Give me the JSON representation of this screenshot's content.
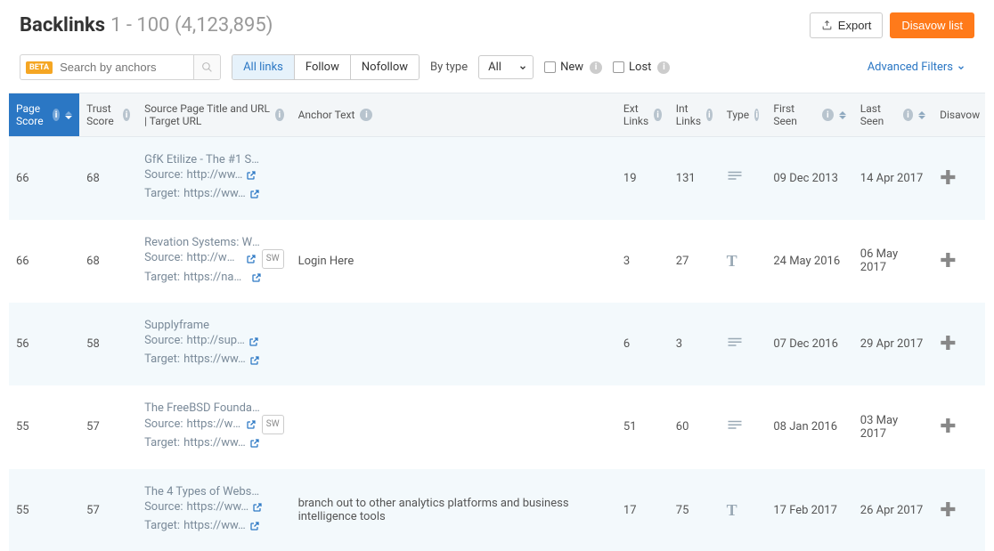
{
  "header": {
    "title": "Backlinks",
    "subtitle": "1 - 100 (4,123,895)",
    "export": "Export",
    "disavow": "Disavow list"
  },
  "toolbar": {
    "beta": "BETA",
    "search_placeholder": "Search by anchors",
    "segments": [
      "All links",
      "Follow",
      "Nofollow"
    ],
    "bytype_label": "By type",
    "bytype_value": "All",
    "new_label": "New",
    "lost_label": "Lost",
    "adv_label": "Advanced Filters"
  },
  "columns": {
    "page_score": "Page Score",
    "trust_score": "Trust Score",
    "source": "Source Page Title and URL | Target URL",
    "anchor": "Anchor Text",
    "ext": "Ext Links",
    "int": "Int Links",
    "type": "Type",
    "first": "First Seen",
    "last": "Last Seen",
    "disavow": "Disavow"
  },
  "rows": [
    {
      "ps": "66",
      "ts": "68",
      "title": "GfK Etilize - The #1 Su…",
      "source": "http://ww…",
      "target": "https://ww…",
      "badge": "",
      "anchor": "",
      "ext": "19",
      "int": "131",
      "type": "lines",
      "first": "09 Dec 2013",
      "last": "14 Apr 2017"
    },
    {
      "ps": "66",
      "ts": "68",
      "title": "Revation Systems: We…",
      "source": "http://ww…",
      "target": "https://na8…",
      "badge": "SW",
      "anchor": "Login Here",
      "ext": "3",
      "int": "27",
      "type": "T",
      "first": "24 May 2016",
      "last": "06 May 2017"
    },
    {
      "ps": "56",
      "ts": "58",
      "title": "Supplyframe",
      "source": "http://sup…",
      "target": "https://ww…",
      "badge": "",
      "anchor": "",
      "ext": "6",
      "int": "3",
      "type": "lines",
      "first": "07 Dec 2016",
      "last": "29 Apr 2017"
    },
    {
      "ps": "55",
      "ts": "57",
      "title": "The FreeBSD Foundat…",
      "source": "https://ww…",
      "target": "https://ww…",
      "badge": "SW",
      "anchor": "",
      "ext": "51",
      "int": "60",
      "type": "lines",
      "first": "08 Jan 2016",
      "last": "03 May 2017"
    },
    {
      "ps": "55",
      "ts": "57",
      "title": "The 4 Types of Websit…",
      "source": "https://ww…",
      "target": "https://ww…",
      "badge": "",
      "anchor": "branch out to other analytics platforms and business intelligence tools",
      "ext": "17",
      "int": "75",
      "type": "T",
      "first": "17 Feb 2017",
      "last": "26 Apr 2017"
    }
  ]
}
